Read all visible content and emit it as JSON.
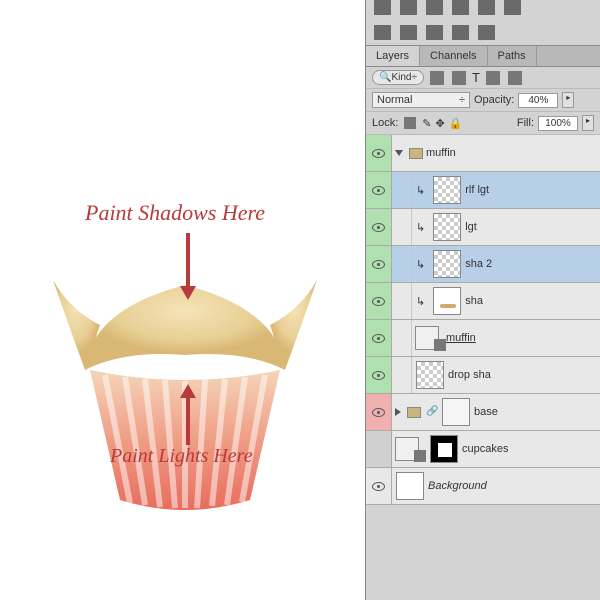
{
  "annot": {
    "shadows": "Paint Shadows Here",
    "lights": "Paint Lights Here"
  },
  "tabs": {
    "layers": "Layers",
    "channels": "Channels",
    "paths": "Paths"
  },
  "filter": {
    "kind": "Kind"
  },
  "blend": {
    "mode": "Normal",
    "opacity_label": "Opacity:",
    "opacity": "40%"
  },
  "lock": {
    "label": "Lock:",
    "fill_label": "Fill:",
    "fill": "100%"
  },
  "layers": {
    "muffin_group": "muffin",
    "rlf": "rlf lgt",
    "lgt": "lgt",
    "sha2": "sha 2",
    "sha": "sha",
    "muffin_so": "muffin",
    "drop": "drop sha",
    "base": "base",
    "cupcakes": "cupcakes",
    "bg": "Background"
  }
}
